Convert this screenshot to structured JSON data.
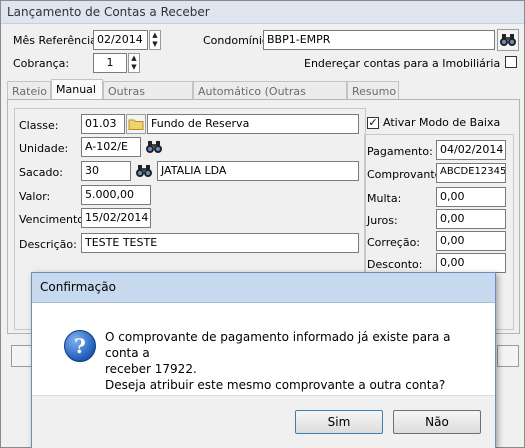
{
  "window": {
    "title": "Lançamento de Contas a Receber"
  },
  "header": {
    "mes_label": "Mês Referência:",
    "mes_value": "02/2014",
    "cobranca_label": "Cobrança:",
    "cobranca_value": "1",
    "condominio_label": "Condomínio:",
    "condominio_value": "BBP1-EMPR",
    "enderecar_label": "Endereçar contas para a Imobiliária"
  },
  "tabs": [
    {
      "label": "Rateio"
    },
    {
      "label": "Manual"
    },
    {
      "label": "Outras Receitas"
    },
    {
      "label": "Automático (Outras Receitas)"
    },
    {
      "label": "Resumo"
    }
  ],
  "form": {
    "classe_label": "Classe:",
    "classe_code": "01.03",
    "classe_desc": "Fundo de Reserva",
    "unidade_label": "Unidade:",
    "unidade_value": "A-102/E",
    "sacado_label": "Sacado:",
    "sacado_code": "30",
    "sacado_name": "JATALIA LDA",
    "valor_label": "Valor:",
    "valor_value": "5.000,00",
    "vencimento_label": "Vencimento:",
    "vencimento_value": "15/02/2014",
    "descricao_label": "Descrição:",
    "descricao_value": "TESTE TESTE"
  },
  "baixa": {
    "ativar_label": "Ativar Modo de Baixa",
    "pagamento_label": "Pagamento:",
    "pagamento_value": "04/02/2014",
    "comprovante_label": "Comprovante:",
    "comprovante_value": "ABCDE12345",
    "multa_label": "Multa:",
    "multa_value": "0,00",
    "juros_label": "Juros:",
    "juros_value": "0,00",
    "correcao_label": "Correção:",
    "correcao_value": "0,00",
    "desconto_label": "Desconto:",
    "desconto_value": "0,00"
  },
  "dialog": {
    "title": "Confirmação",
    "line1": "O comprovante de pagamento informado já existe para a conta a",
    "line2": "receber 17922.",
    "line3": "Deseja atribuir este mesmo comprovante a outra conta?",
    "yes": "Sim",
    "no": "Não"
  },
  "icons": {
    "binoculars": "binoculars-icon",
    "folder": "folder-icon",
    "info": "information-icon"
  }
}
